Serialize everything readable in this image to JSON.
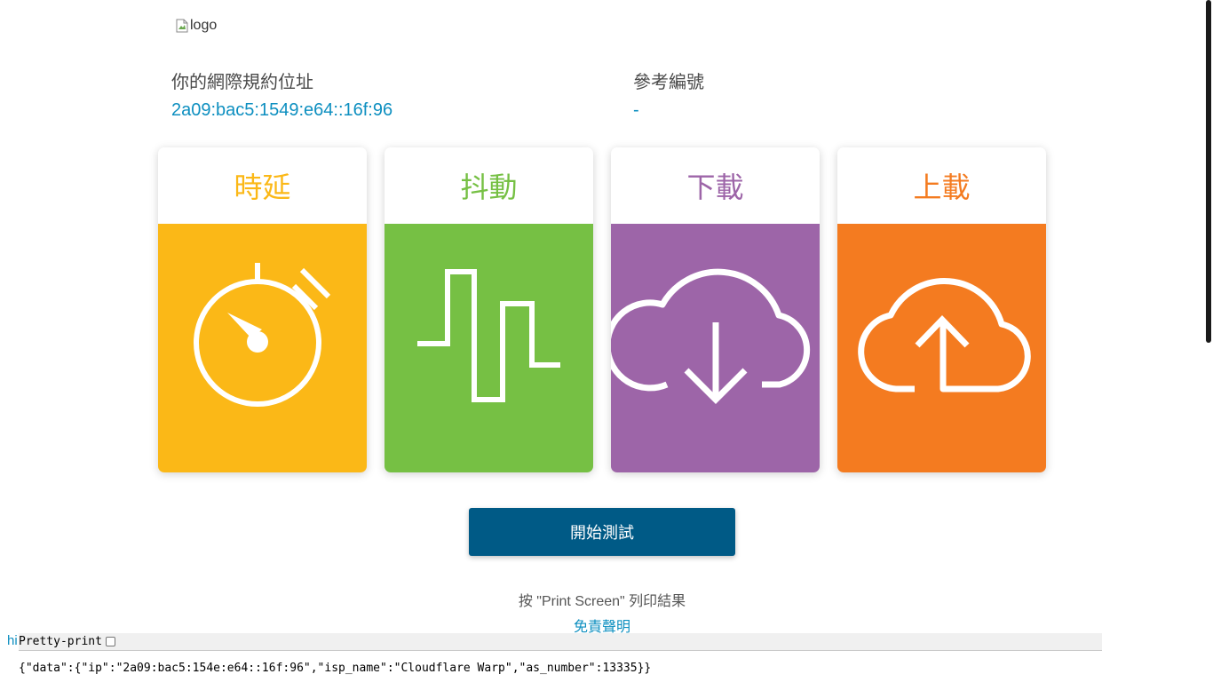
{
  "logo": {
    "alt_text": "logo"
  },
  "ip_section": {
    "label": "你的網際規約位址",
    "value": "2a09:bac5:1549:e64::16f:96"
  },
  "ref_section": {
    "label": "參考編號",
    "value": "-"
  },
  "cards": [
    {
      "title": "時延",
      "icon": "stopwatch-icon",
      "color": "#fbb817"
    },
    {
      "title": "抖動",
      "icon": "jitter-wave-icon",
      "color": "#76c044"
    },
    {
      "title": "下載",
      "icon": "cloud-download-icon",
      "color": "#9d65a8"
    },
    {
      "title": "上載",
      "icon": "cloud-upload-icon",
      "color": "#f47b20"
    }
  ],
  "start_button": {
    "label": "開始測試",
    "color": "#005a86"
  },
  "print_hint": "按 \"Print Screen\" 列印結果",
  "disclaimer": "免責聲明",
  "hi_link": "hi",
  "pretty_print": {
    "label": "Pretty-print",
    "checked": false
  },
  "json_text": "{\"data\":{\"ip\":\"2a09:bac5:154e:e64::16f:96\",\"isp_name\":\"Cloudflare Warp\",\"as_number\":13335}}"
}
